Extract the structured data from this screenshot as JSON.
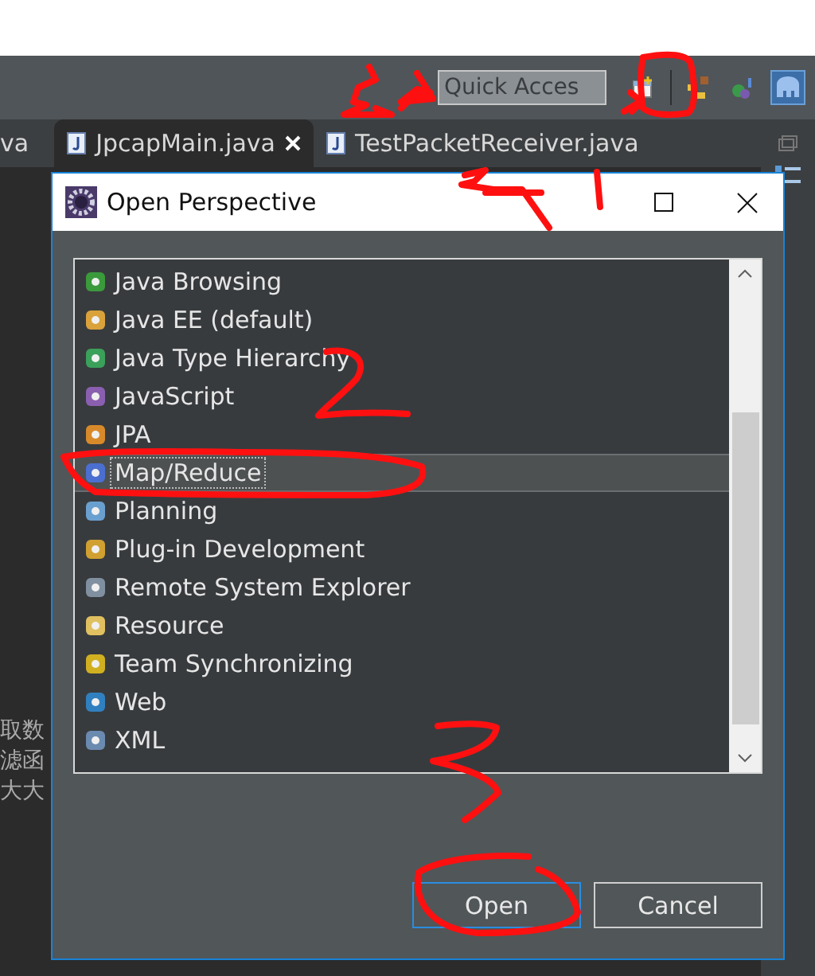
{
  "toolbar": {
    "quick_access": {
      "placeholder": "Quick Acces"
    }
  },
  "editor_tabs": [
    {
      "label": "va",
      "selected": false
    },
    {
      "label": "JpcapMain.java",
      "selected": true
    },
    {
      "label": "TestPacketReceiver.java",
      "selected": false
    }
  ],
  "editor_lines": [
    "取数",
    "滤函",
    "大大"
  ],
  "dialog": {
    "title": "Open Perspective",
    "perspectives": [
      {
        "label": "Java Browsing",
        "selected": false
      },
      {
        "label": "Java EE (default)",
        "selected": false
      },
      {
        "label": "Java Type Hierarchy",
        "selected": false
      },
      {
        "label": "JavaScript",
        "selected": false
      },
      {
        "label": "JPA",
        "selected": false
      },
      {
        "label": "Map/Reduce",
        "selected": true
      },
      {
        "label": "Planning",
        "selected": false
      },
      {
        "label": "Plug-in Development",
        "selected": false
      },
      {
        "label": "Remote System Explorer",
        "selected": false
      },
      {
        "label": "Resource",
        "selected": false
      },
      {
        "label": "Team Synchronizing",
        "selected": false
      },
      {
        "label": "Web",
        "selected": false
      },
      {
        "label": "XML",
        "selected": false
      }
    ],
    "buttons": [
      {
        "label": "Open",
        "default": true
      },
      {
        "label": "Cancel",
        "default": false
      }
    ]
  }
}
